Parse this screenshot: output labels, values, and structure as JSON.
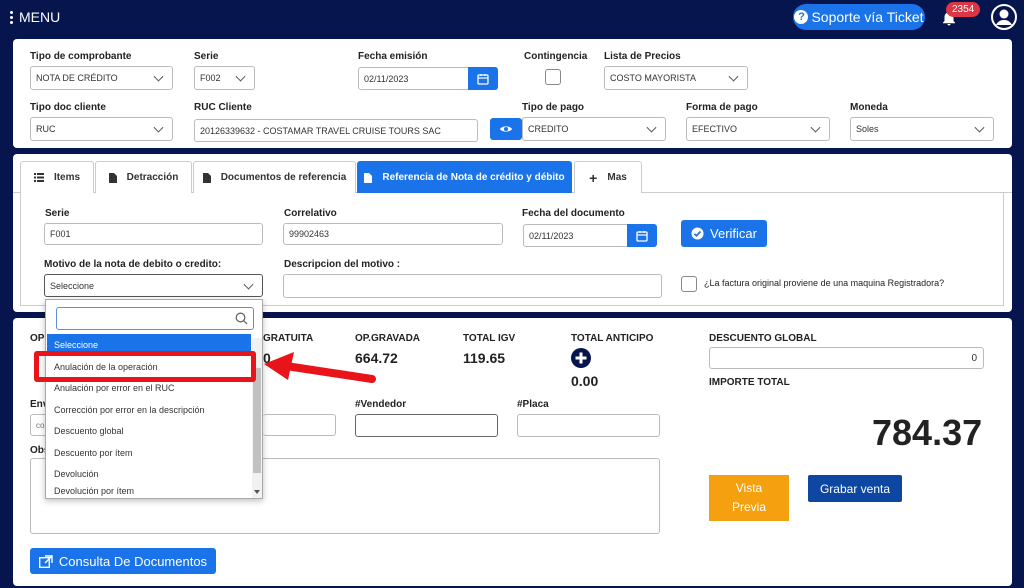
{
  "topbar": {
    "menu_label": "MENU",
    "support_label": "Soporte vía Ticket",
    "notif_count": "2354"
  },
  "form1": {
    "tipo_comprobante": {
      "label": "Tipo de comprobante",
      "value": "NOTA DE CRÉDITO"
    },
    "serie": {
      "label": "Serie",
      "value": "F002"
    },
    "fecha_emision": {
      "label": "Fecha emisión",
      "value": "02/11/2023"
    },
    "contingencia": {
      "label": "Contingencia"
    },
    "lista_precios": {
      "label": "Lista de Precios",
      "value": "COSTO MAYORISTA"
    },
    "tipo_doc_cliente": {
      "label": "Tipo doc cliente",
      "value": "RUC"
    },
    "ruc_cliente": {
      "label": "RUC Cliente",
      "value": "20126339632 - COSTAMAR TRAVEL CRUISE  TOURS SAC"
    },
    "tipo_pago": {
      "label": "Tipo de pago",
      "value": "CREDITO"
    },
    "forma_pago": {
      "label": "Forma de pago",
      "value": "EFECTIVO"
    },
    "moneda": {
      "label": "Moneda",
      "value": "Soles"
    }
  },
  "tabs": [
    {
      "label": "Items"
    },
    {
      "label": "Detracción"
    },
    {
      "label": "Documentos de referencia"
    },
    {
      "label": "Referencia de Nota de crédito y débito"
    },
    {
      "label": "Mas"
    }
  ],
  "ref": {
    "serie": {
      "label": "Serie",
      "value": "F001"
    },
    "correlativo": {
      "label": "Correlativo",
      "value": "99902463"
    },
    "fecha_doc": {
      "label": "Fecha del documento",
      "value": "02/11/2023"
    },
    "verify_label": "Verificar",
    "motivo": {
      "label": "Motivo de la nota de debito o credito:",
      "value": "Seleccione"
    },
    "descripcion": {
      "label": "Descripcion del motivo :"
    },
    "registradora_label": "¿La factura original proviene de una maquina Registradora?"
  },
  "dropdown": {
    "items": [
      "Seleccione",
      "Anulación de la operación",
      "Anulación por error en el RUC",
      "Corrección por error en la descripción",
      "Descuento global",
      "Descuento por ítem",
      "Devolución",
      "Devolución por ítem"
    ]
  },
  "totals": {
    "op_partial": "OP",
    "gratuita_label": "GRATUITA",
    "gratuita_value": "0",
    "gravada_label": "OP.GRAVADA",
    "gravada_value": "664.72",
    "igv_label": "TOTAL IGV",
    "igv_value": "119.65",
    "anticipo_label": "TOTAL ANTICIPO",
    "anticipo_value": "0.00",
    "descuento_label": "DESCUENTO GLOBAL",
    "descuento_value": "0",
    "importe_label": "IMPORTE TOTAL",
    "importe_value": "784.37"
  },
  "lower": {
    "env_partial": "Env",
    "con_partial": "cor",
    "obs_partial": "Obs",
    "vendedor_label": "#Vendedor",
    "placa_label": "#Placa"
  },
  "buttons": {
    "vista_line1": "Vista",
    "vista_line2": "Previa",
    "grabar": "Grabar venta",
    "consulta": "Consulta De Documentos"
  },
  "colors": {
    "navy": "#06154d",
    "primary": "#1a73e8",
    "orange": "#f5a00e",
    "highlight_red": "#e8141a"
  }
}
